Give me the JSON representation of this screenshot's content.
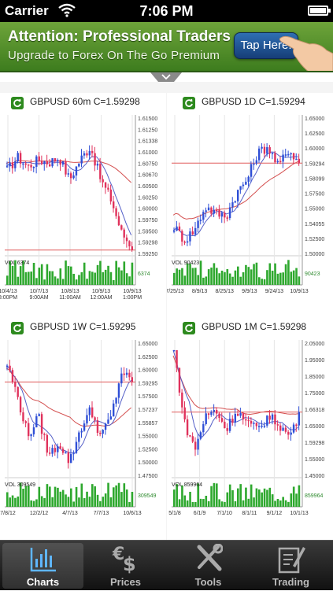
{
  "status": {
    "carrier": "Carrier",
    "time": "7:06 PM"
  },
  "banner": {
    "headline": "Attention: Professional Traders",
    "subline": "Upgrade to Forex On The Go Premium",
    "cta": "Tap Here!"
  },
  "colors": {
    "up": "#2f4fd6",
    "down": "#e0325c",
    "volume": "#2ea82e",
    "ma_fast": "#5560c8",
    "ma_slow": "#d45050"
  },
  "charts": [
    {
      "title": "GBPUSD 60m C=1.59298",
      "prices": [
        "1.61500",
        "1.61250",
        "1.61338",
        "1.61000",
        "1.60750",
        "1.60670",
        "1.60500",
        "1.60250",
        "1.60000",
        "1.59750",
        "1.59500",
        "1.59298",
        "1.59250"
      ],
      "vol_label": "VOL 6374",
      "vol_value": "6374",
      "dates": [
        [
          "10/4/13",
          "8:00PM"
        ],
        [
          "10/7/13",
          "9:00AM"
        ],
        [
          "10/8/13",
          "11:00AM"
        ],
        [
          "10/9/13",
          "12:00AM"
        ],
        [
          "10/9/13",
          "1:00PM"
        ]
      ]
    },
    {
      "title": "GBPUSD 1D C=1.59294",
      "prices": [
        "1.65000",
        "1.62500",
        "1.60000",
        "1.59294",
        "1.58099",
        "1.57500",
        "1.55000",
        "1.54055",
        "1.52500",
        "1.50000"
      ],
      "vol_label": "VOL 90423",
      "vol_value": "90423",
      "dates": [
        [
          "7/25/13"
        ],
        [
          "8/9/13"
        ],
        [
          "8/25/13"
        ],
        [
          "9/9/13"
        ],
        [
          "9/24/13"
        ],
        [
          "10/9/13"
        ]
      ]
    },
    {
      "title": "GBPUSD 1W C=1.59295",
      "prices": [
        "1.65000",
        "1.62500",
        "1.60000",
        "1.59295",
        "1.57500",
        "1.57237",
        "1.55857",
        "1.55000",
        "1.52500",
        "1.50000",
        "1.47500"
      ],
      "vol_label": "VOL 309549",
      "vol_value": "309549",
      "dates": [
        [
          "7/8/12"
        ],
        [
          "12/2/12"
        ],
        [
          "4/7/13"
        ],
        [
          "7/7/13"
        ],
        [
          "10/6/13"
        ]
      ]
    },
    {
      "title": "GBPUSD 1M C=1.59298",
      "prices": [
        "2.05000",
        "1.95000",
        "1.85000",
        "1.75000",
        "1.66318",
        "1.65000",
        "1.59298",
        "1.55000",
        "1.45000"
      ],
      "vol_label": "VOL 859964",
      "vol_value": "859964",
      "dates": [
        [
          "5/1/8"
        ],
        [
          "6/1/9"
        ],
        [
          "7/1/10"
        ],
        [
          "8/1/11"
        ],
        [
          "9/1/12"
        ],
        [
          "10/1/13"
        ]
      ]
    }
  ],
  "tabs": [
    {
      "label": "Charts",
      "icon": "charts-icon"
    },
    {
      "label": "Prices",
      "icon": "prices-icon"
    },
    {
      "label": "Tools",
      "icon": "tools-icon"
    },
    {
      "label": "Trading",
      "icon": "trading-icon"
    }
  ]
}
